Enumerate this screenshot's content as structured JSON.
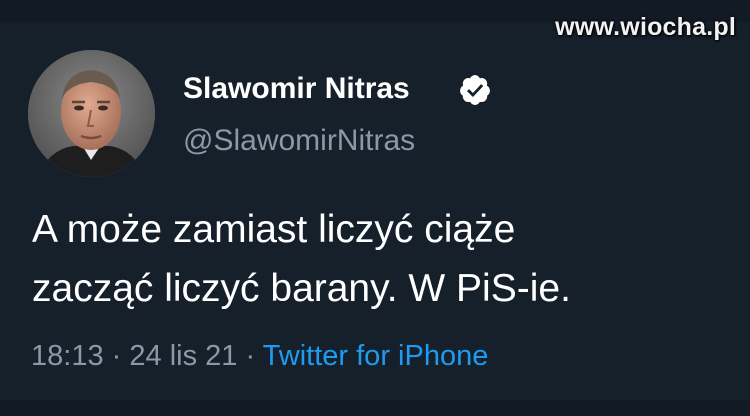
{
  "watermark": "www.wiocha.pl",
  "tweet": {
    "display_name": "Slawomir Nitras",
    "handle": "@SlawomirNitras",
    "verified_icon": "verified-badge-icon",
    "text_lines": [
      "A może zamiast liczyć ciąże",
      "zacząć liczyć barany. W PiS-ie."
    ],
    "time": "18:13",
    "separator": "·",
    "date": "24 lis 21",
    "source": "Twitter for iPhone"
  },
  "colors": {
    "background": "#15202b",
    "text": "#ffffff",
    "muted": "#8b98a5",
    "accent": "#1d9bf0"
  }
}
